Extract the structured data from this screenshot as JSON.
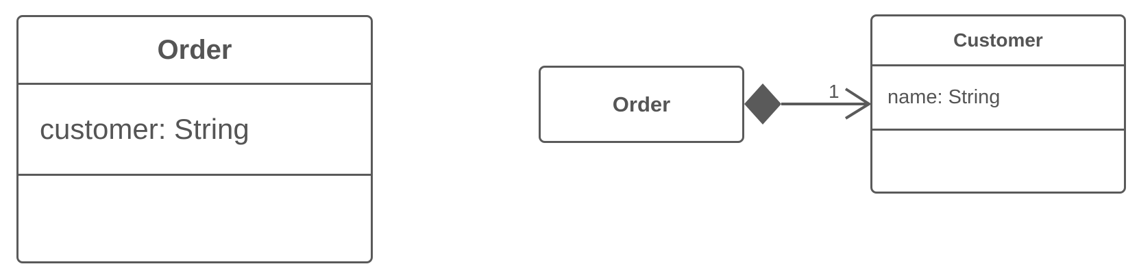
{
  "diagrams": {
    "left": {
      "class_name": "Order",
      "attributes": [
        "customer: String"
      ]
    },
    "right": {
      "source_class": "Order",
      "target_class": {
        "name": "Customer",
        "attributes": [
          "name: String"
        ]
      },
      "relationship": {
        "type": "composition",
        "multiplicity": "1"
      }
    }
  },
  "colors": {
    "stroke": "#5a5a5a",
    "text": "#555555",
    "background": "#ffffff"
  }
}
